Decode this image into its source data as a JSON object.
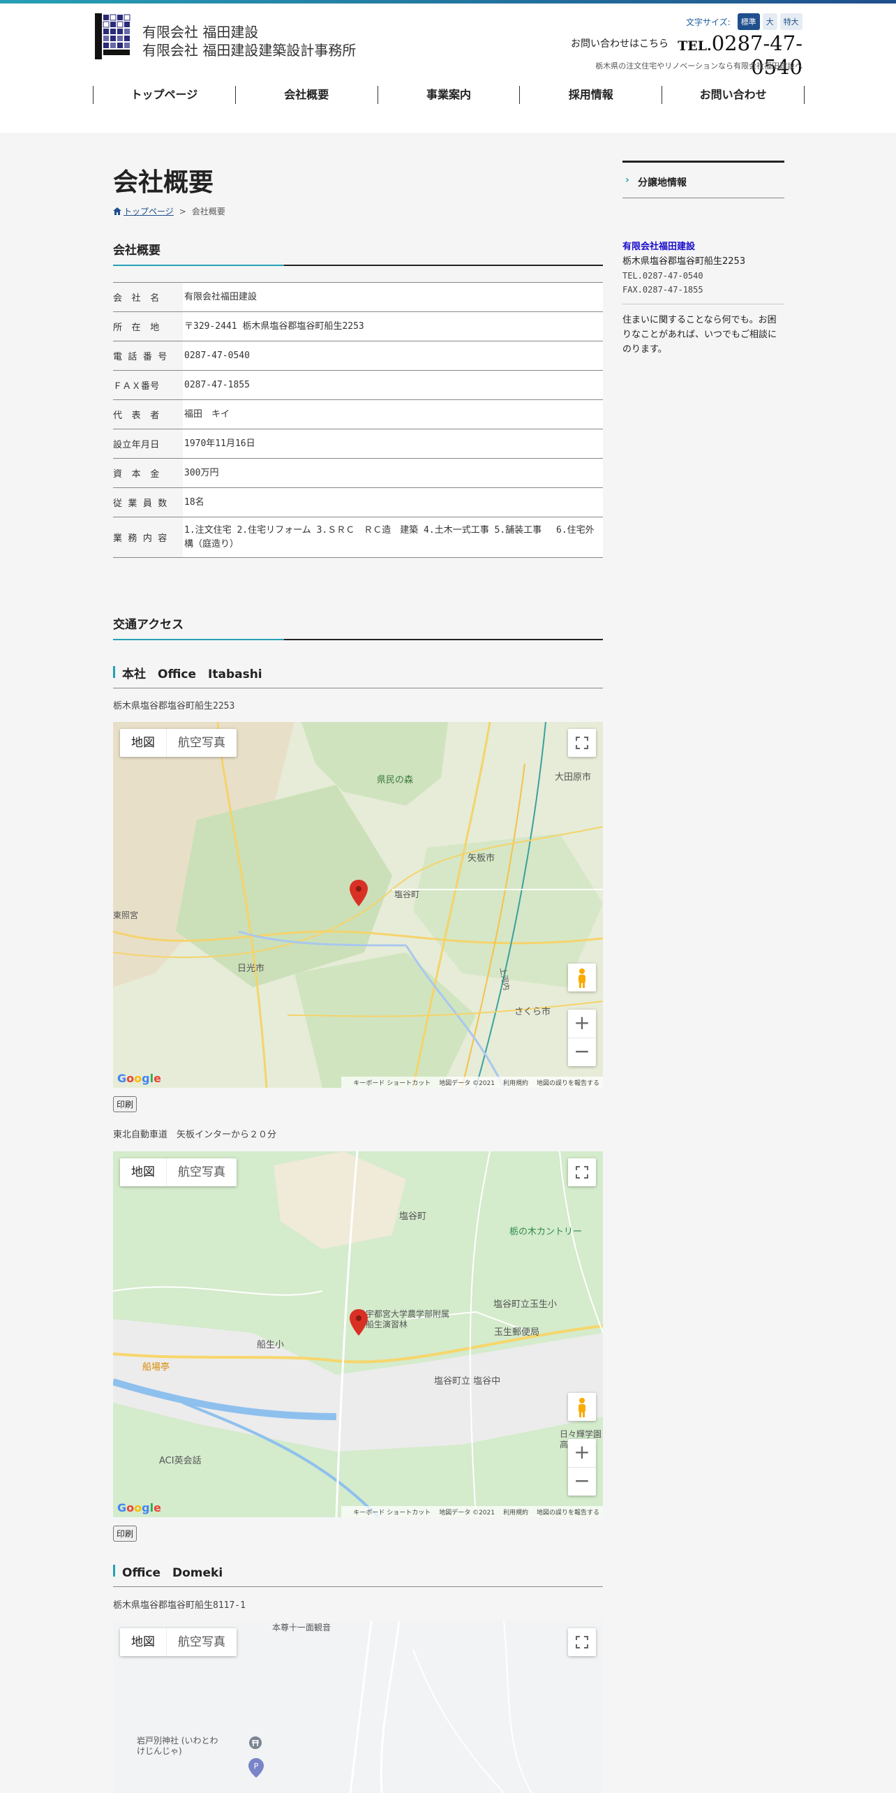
{
  "header": {
    "company_line1": "有限会社 福田建設",
    "company_line2": "有限会社 福田建設建築設計事務所",
    "font_size_label": "文字サイズ:",
    "font_sizes": [
      "標準",
      "大",
      "特大"
    ],
    "contact_lead": "お問い合わせはこちら",
    "tel_prefix": "TEL.",
    "tel_number": "0287-47-0540",
    "tagline": "栃木県の注文住宅やリノベーションなら有限会社福田建設へ"
  },
  "nav": [
    "トップページ",
    "会社概要",
    "事業案内",
    "採用情報",
    "お問い合わせ"
  ],
  "page": {
    "title": "会社概要",
    "breadcrumb_home": "トップページ",
    "breadcrumb_sep": ">",
    "breadcrumb_current": "会社概要"
  },
  "overview": {
    "heading": "会社概要",
    "rows": [
      {
        "key": "会　社　名",
        "value": "有限会社福田建設"
      },
      {
        "key": "所　在　地",
        "value": "〒329-2441 栃木県塩谷郡塩谷町船生2253"
      },
      {
        "key": "電 話 番 号",
        "value": "0287-47-0540"
      },
      {
        "key": "ＦＡＸ番号",
        "value": "0287-47-1855"
      },
      {
        "key": "代　表　者",
        "value": "福田　キイ"
      },
      {
        "key": "設立年月日",
        "value": "1970年11月16日"
      },
      {
        "key": "資　本　金",
        "value": "300万円"
      },
      {
        "key": "従 業 員 数",
        "value": "18名"
      },
      {
        "key": "業 務 内 容",
        "value": "1.注文住宅 2.住宅リフォーム 3.ＳＲＣ　ＲＣ造　建築 4.土木一式工事 5.舗装工事　 6.住宅外構（庭造り）"
      }
    ]
  },
  "access": {
    "heading": "交通アクセス",
    "office1": {
      "title": "本社　Office　Itabashi",
      "address": "栃木県塩谷郡塩谷町船生2253",
      "note": "東北自動車道　矢板インターから２０分"
    },
    "office2": {
      "title": "Office　Domeki",
      "address": "栃木県塩谷郡塩谷町船生8117-1"
    },
    "print_label": "印刷",
    "map": {
      "type_map": "地図",
      "type_satellite": "航空写真",
      "attr_shortcuts": "キーボード ショートカット",
      "attr_data": "地図データ ©2021",
      "attr_terms": "利用規約",
      "attr_report": "地図の誤りを報告する",
      "google": "Google",
      "map1_labels": [
        "県民の森",
        "大田原市",
        "矢板市",
        "塩谷町",
        "東照宮",
        "日光市",
        "さくら市",
        "上河内"
      ],
      "map2_labels": [
        "塩谷町",
        "栃の木カントリー",
        "塩谷町立玉生小",
        "玉生郵便局",
        "船生小",
        "宇都宮大学農学部附属船生演習林",
        "塩谷町立 塩谷中",
        "船場亭",
        "ACI英会話",
        "日々輝学園高等学校"
      ],
      "map3_labels": [
        "岩戸別神社 (いわとわけじんじゃ)",
        "本尊十一面観音"
      ]
    }
  },
  "sidebar": {
    "link": "分譲地情報",
    "company": "有限会社福田建設",
    "address": "栃木県塩谷郡塩谷町船生2253",
    "tel": "TEL.0287-47-0540",
    "fax": "FAX.0287-47-1855",
    "message": "住まいに関することなら何でも。お困りなことがあれば、いつでもご相談にのります。"
  },
  "colors": {
    "accent": "#27a0b6",
    "navy": "#1f4f8c",
    "link": "#1a0dcc",
    "pin": "#d93025"
  }
}
